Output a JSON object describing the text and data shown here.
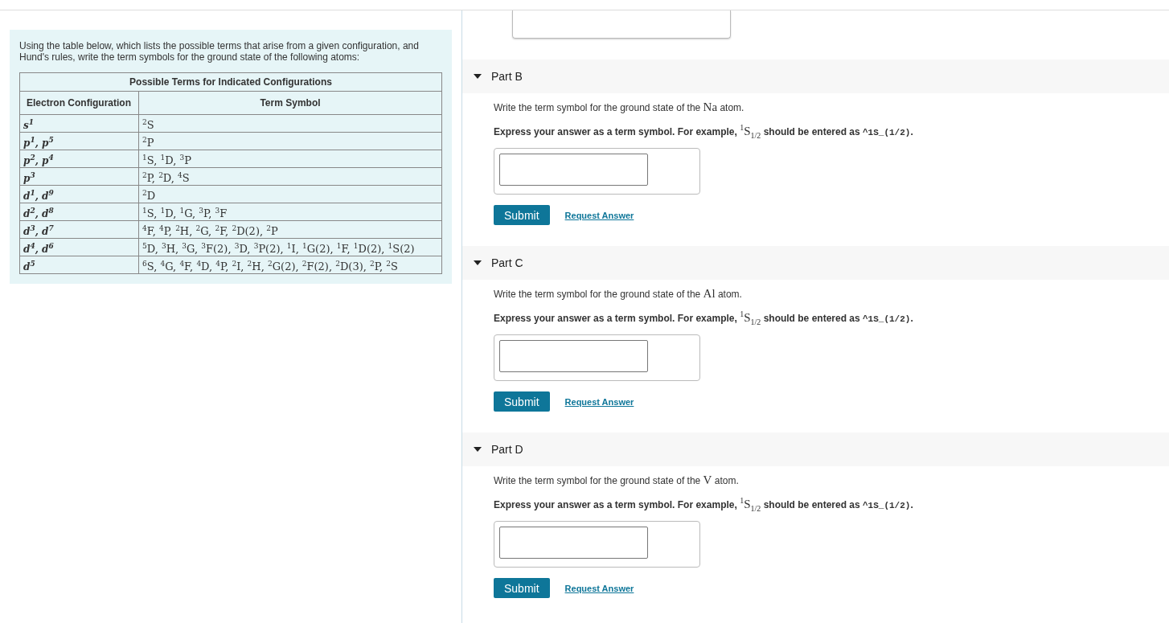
{
  "intro": "Using the table below, which lists the possible terms that arise from a given configuration, and Hund's rules, write the term symbols for the ground state of the following atoms:",
  "table": {
    "caption": "Possible Terms for Indicated Configurations",
    "columns": [
      "Electron Configuration",
      "Term Symbol"
    ],
    "rows": [
      [
        "s$^{1}$",
        "$^{2}$S"
      ],
      [
        "p$^{1}$, p$^{5}$",
        "$^{2}$P"
      ],
      [
        "p$^{2}$, p$^{4}$",
        "$^{1}$S, $^{1}$D, $^{3}$P"
      ],
      [
        "p$^{3}$",
        "$^{2}$P, $^{2}$D, $^{4}$S"
      ],
      [
        "d$^{1}$, d$^{9}$",
        "$^{2}$D"
      ],
      [
        "d$^{2}$, d$^{8}$",
        "$^{1}$S, $^{1}$D, $^{1}$G, $^{3}$P, $^{3}$F"
      ],
      [
        "d$^{3}$, d$^{7}$",
        "$^{4}$F, $^{4}$P, $^{2}$H, $^{2}$G, $^{2}$F, $^{2}$D(2), $^{2}$P"
      ],
      [
        "d$^{4}$, d$^{6}$",
        "$^{5}$D, $^{3}$H, $^{3}$G, $^{3}$F(2), $^{3}$D, $^{3}$P(2), $^{1}$I, $^{1}$G(2), $^{1}$F, $^{1}$D(2), $^{1}$S(2)"
      ],
      [
        "d$^{5}$",
        "$^{6}$S, $^{4}$G, $^{4}$F, $^{4}$D, $^{4}$P, $^{2}$I, $^{2}$H, $^{2}$G(2), $^{2}$F(2), $^{2}$D(3), $^{2}$P, $^{2}$S"
      ]
    ]
  },
  "parts": [
    {
      "title": "Part B",
      "expanded": true,
      "prompt_before": "Write the term symbol for the ground state of the",
      "element": "Na",
      "prompt_after": "atom.",
      "hint_before": "Express your answer as a term symbol. For example,",
      "hint_example": "$^{1}$S$_{1/2}$",
      "hint_middle": "should be entered as",
      "hint_code": "^1S_(1/2)",
      "hint_end": ".",
      "submit": "Submit",
      "request": "Request Answer"
    },
    {
      "title": "Part C",
      "expanded": true,
      "prompt_before": "Write the term symbol for the ground state of the",
      "element": "Al",
      "prompt_after": "atom.",
      "hint_before": "Express your answer as a term symbol. For example,",
      "hint_example": "$^{1}$S$_{1/2}$",
      "hint_middle": "should be entered as",
      "hint_code": "^1S_(1/2)",
      "hint_end": ".",
      "submit": "Submit",
      "request": "Request Answer"
    },
    {
      "title": "Part D",
      "expanded": true,
      "prompt_before": "Write the term symbol for the ground state of the",
      "element": "V",
      "prompt_after": "atom.",
      "hint_before": "Express your answer as a term symbol. For example,",
      "hint_example": "$^{1}$S$_{1/2}$",
      "hint_middle": "should be entered as",
      "hint_code": "^1S_(1/2)",
      "hint_end": ".",
      "submit": "Submit",
      "request": "Request Answer"
    }
  ]
}
